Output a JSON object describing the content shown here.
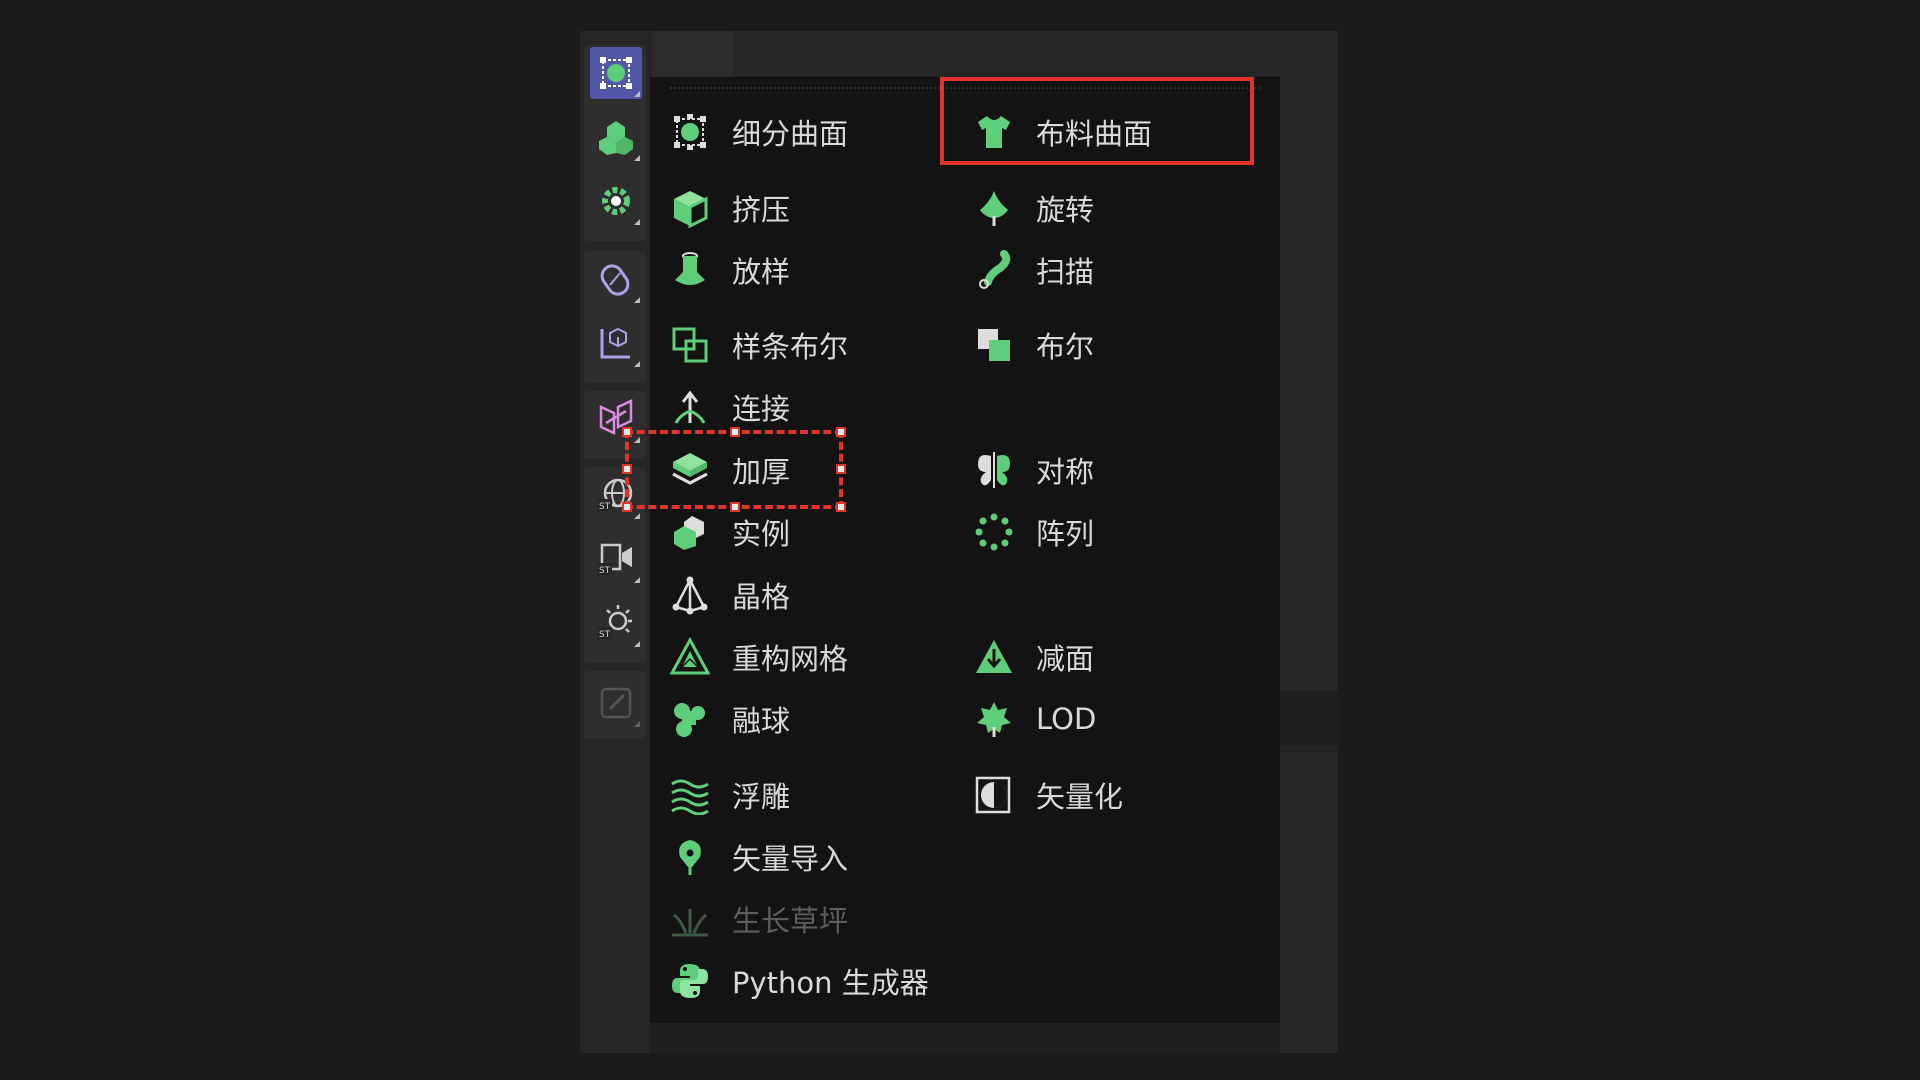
{
  "colors": {
    "accent_green": "#5fce7a",
    "active_purple": "#5157a6",
    "highlight_red": "#e0352b",
    "icon_purple": "#a8a2e8"
  },
  "toolbar": {
    "buttons": [
      {
        "icon": "subdivision-surface-icon",
        "active": true
      },
      {
        "icon": "cloner-icon",
        "active": false
      },
      {
        "icon": "gear-deformer-icon",
        "active": false
      },
      {
        "icon": "spline-pen-icon",
        "active": false
      },
      {
        "icon": "coordinate-icon",
        "active": false
      },
      {
        "icon": "field-icon",
        "active": false
      },
      {
        "icon": "globe-sky-icon",
        "active": false
      },
      {
        "icon": "camera-icon",
        "active": false
      },
      {
        "icon": "light-icon",
        "active": false
      },
      {
        "icon": "edit-tag-icon",
        "active": false
      }
    ]
  },
  "menu": {
    "items": [
      {
        "label": "细分曲面",
        "icon": "subdivision-surface-icon"
      },
      {
        "label": "布料曲面",
        "icon": "cloth-surface-icon"
      },
      {
        "label": "挤压",
        "icon": "extrude-icon"
      },
      {
        "label": "旋转",
        "icon": "lathe-icon"
      },
      {
        "label": "放样",
        "icon": "loft-icon"
      },
      {
        "label": "扫描",
        "icon": "sweep-icon"
      },
      {
        "label": "样条布尔",
        "icon": "spline-boole-icon"
      },
      {
        "label": "布尔",
        "icon": "boole-icon"
      },
      {
        "label": "连接",
        "icon": "connect-icon"
      },
      {
        "label": "加厚",
        "icon": "thicken-icon"
      },
      {
        "label": "对称",
        "icon": "symmetry-icon"
      },
      {
        "label": "实例",
        "icon": "instance-icon"
      },
      {
        "label": "阵列",
        "icon": "array-icon"
      },
      {
        "label": "晶格",
        "icon": "atom-array-icon"
      },
      {
        "label": "重构网格",
        "icon": "remesh-icon"
      },
      {
        "label": "减面",
        "icon": "polygon-reduction-icon"
      },
      {
        "label": "融球",
        "icon": "metaball-icon"
      },
      {
        "label": "LOD",
        "icon": "lod-icon"
      },
      {
        "label": "浮雕",
        "icon": "relief-icon"
      },
      {
        "label": "矢量化",
        "icon": "vectorizer-icon"
      },
      {
        "label": "矢量导入",
        "icon": "vector-import-icon"
      },
      {
        "label": "生长草坪",
        "icon": "grass-icon",
        "disabled": true
      },
      {
        "label": "Python 生成器",
        "icon": "python-icon"
      }
    ]
  }
}
